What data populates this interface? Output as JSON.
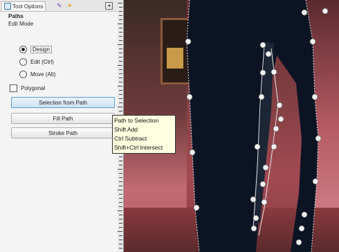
{
  "tabs": {
    "tool_options_label": "Tool Options",
    "tool_options_icon": "tool-options-icon",
    "second_icon": "paths-dialog-icon",
    "third_icon": "brushes-dialog-icon",
    "menu_icon": "panel-menu-icon"
  },
  "tool": {
    "name": "Paths",
    "edit_mode_label": "Edit Mode",
    "modes": [
      {
        "label": "Design",
        "selected": true
      },
      {
        "label": "Edit (Ctrl)",
        "selected": false
      },
      {
        "label": "Move (Alt)",
        "selected": false
      }
    ],
    "polygonal_label": "Polygonal",
    "polygonal_checked": false
  },
  "buttons": {
    "selection_from_path": "Selection from Path",
    "fill_path": "Fill Path",
    "stroke_path": "Stroke Path"
  },
  "tooltip": {
    "lines": [
      "Path to Selection",
      "Shift Add",
      "Ctrl Subtract",
      "Shift+Ctrl Intersect"
    ]
  },
  "colors": {
    "accent": "#5d9bd6",
    "path_node": "#f2f2f2",
    "tooltip_bg": "#ffffe1"
  }
}
